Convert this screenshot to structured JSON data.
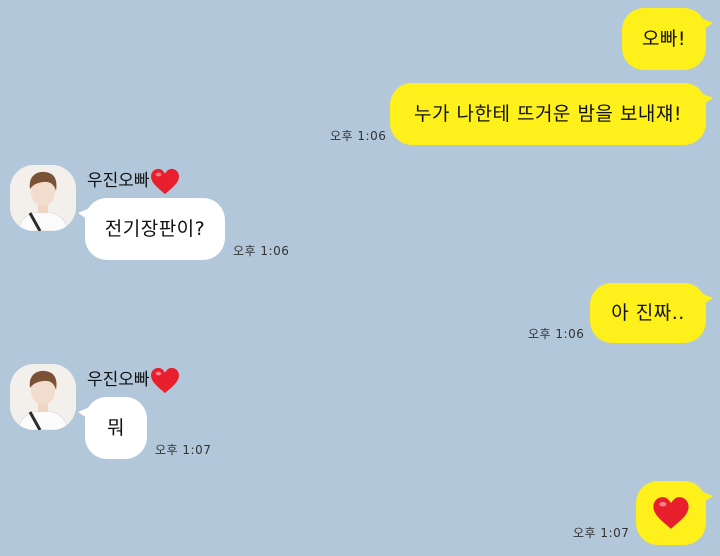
{
  "messages": [
    {
      "side": "right",
      "text": "오빠!",
      "time": ""
    },
    {
      "side": "right",
      "text": "누가 나한테 뜨거운 밤을 보내쟤!",
      "time": "오후 1:06"
    },
    {
      "side": "left",
      "sender": "우진오빠",
      "sender_icon": "red-heart-icon",
      "text": "전기장판이?",
      "time": "오후 1:06"
    },
    {
      "side": "right",
      "text": "아 진짜..",
      "time": "오후 1:06"
    },
    {
      "side": "left",
      "sender": "우진오빠",
      "sender_icon": "red-heart-icon",
      "text": "뭐",
      "time": "오후 1:07"
    },
    {
      "side": "right",
      "text": "",
      "icon": "red-heart-icon",
      "time": "오후 1:07"
    }
  ],
  "colors": {
    "background": "#b2c7da",
    "my_bubble": "#fef01b",
    "their_bubble": "#ffffff",
    "heart": "#e8202e"
  }
}
